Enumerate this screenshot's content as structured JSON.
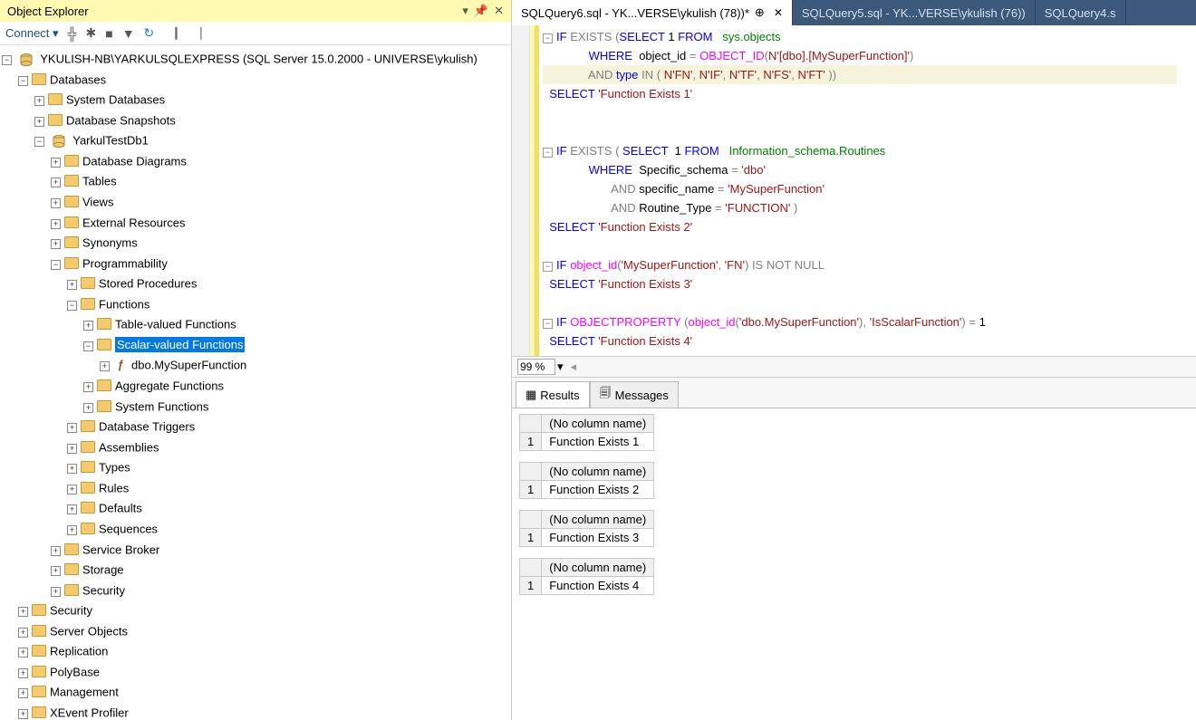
{
  "panel": {
    "title": "Object Explorer",
    "connect": "Connect"
  },
  "tree": {
    "server": "YKULISH-NB\\YARKULSQLEXPRESS (SQL Server 15.0.2000 - UNIVERSE\\ykulish)",
    "databases": "Databases",
    "sysdb": "System Databases",
    "snapshots": "Database Snapshots",
    "testdb": "YarkulTestDb1",
    "dbdiag": "Database Diagrams",
    "tables": "Tables",
    "views": "Views",
    "ext": "External Resources",
    "syn": "Synonyms",
    "prog": "Programmability",
    "sp": "Stored Procedures",
    "fn": "Functions",
    "tvf": "Table-valued Functions",
    "svf": "Scalar-valued Functions",
    "myfn": "dbo.MySuperFunction",
    "aggfn": "Aggregate Functions",
    "sysfn": "System Functions",
    "dbtrig": "Database Triggers",
    "asm": "Assemblies",
    "types": "Types",
    "rules": "Rules",
    "defaults": "Defaults",
    "seq": "Sequences",
    "sbroker": "Service Broker",
    "storage": "Storage",
    "sec_db": "Security",
    "sec": "Security",
    "srvobj": "Server Objects",
    "repl": "Replication",
    "polyb": "PolyBase",
    "mgmt": "Management",
    "xe": "XEvent Profiler"
  },
  "tabs": {
    "t1": "SQLQuery6.sql - YK...VERSE\\ykulish (78))*",
    "t2": "SQLQuery5.sql - YK...VERSE\\ykulish (76))",
    "t3": "SQLQuery4.s"
  },
  "zoom": "99 %",
  "resultTabs": {
    "results": "Results",
    "messages": "Messages"
  },
  "results": {
    "hdr": "(No column name)",
    "r1": "Function Exists 1",
    "r2": "Function Exists 2",
    "r3": "Function Exists 3",
    "r4": "Function Exists 4",
    "row": "1"
  }
}
